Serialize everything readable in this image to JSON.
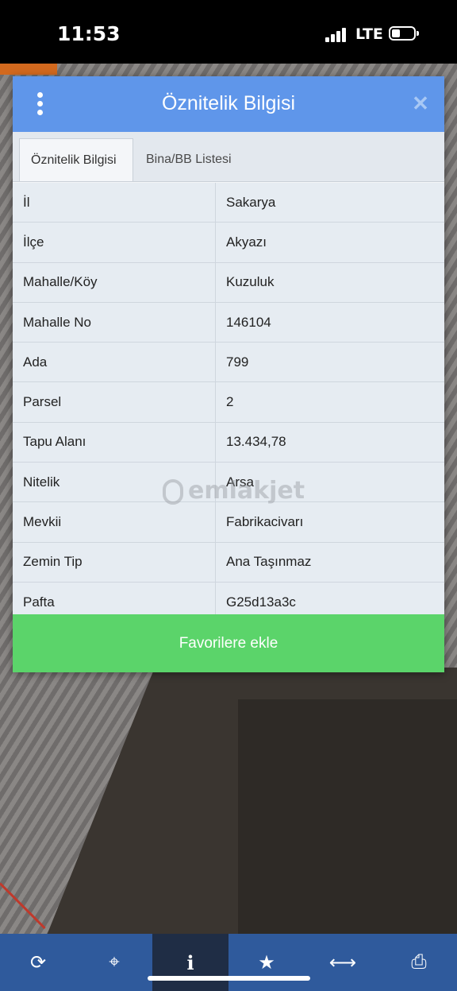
{
  "status_bar": {
    "time": "11:53",
    "network": "LTE"
  },
  "dialog": {
    "title": "Öznitelik Bilgisi",
    "tabs": [
      {
        "label": "Öznitelik Bilgisi",
        "active": true
      },
      {
        "label": "Bina/BB Listesi",
        "active": false
      }
    ],
    "rows": [
      {
        "label": "İl",
        "value": "Sakarya"
      },
      {
        "label": "İlçe",
        "value": "Akyazı"
      },
      {
        "label": "Mahalle/Köy",
        "value": "Kuzuluk"
      },
      {
        "label": "Mahalle No",
        "value": "146104"
      },
      {
        "label": "Ada",
        "value": "799"
      },
      {
        "label": "Parsel",
        "value": "2"
      },
      {
        "label": "Tapu Alanı",
        "value": "13.434,78"
      },
      {
        "label": "Nitelik",
        "value": "Arsa"
      },
      {
        "label": "Mevkii",
        "value": "Fabrikacivarı"
      },
      {
        "label": "Zemin Tip",
        "value": "Ana Taşınmaz"
      },
      {
        "label": "Pafta",
        "value": "G25d13a3c"
      }
    ],
    "favorite_button": "Favorilere ekle"
  },
  "watermark": "emlakjet",
  "toolbar": {
    "items": [
      {
        "icon": "refresh-icon",
        "glyph": "⟳"
      },
      {
        "icon": "locate-icon",
        "glyph": "⌖"
      },
      {
        "icon": "info-icon",
        "glyph": "i",
        "active": true
      },
      {
        "icon": "star-icon",
        "glyph": "★"
      },
      {
        "icon": "measure-icon",
        "glyph": "⟷"
      },
      {
        "icon": "print-icon",
        "glyph": "⎙"
      }
    ]
  },
  "colors": {
    "header": "#5f96ea",
    "favorite_button": "#5bd46a",
    "toolbar": "#2f5a9c",
    "toolbar_active": "#1f2d45"
  }
}
